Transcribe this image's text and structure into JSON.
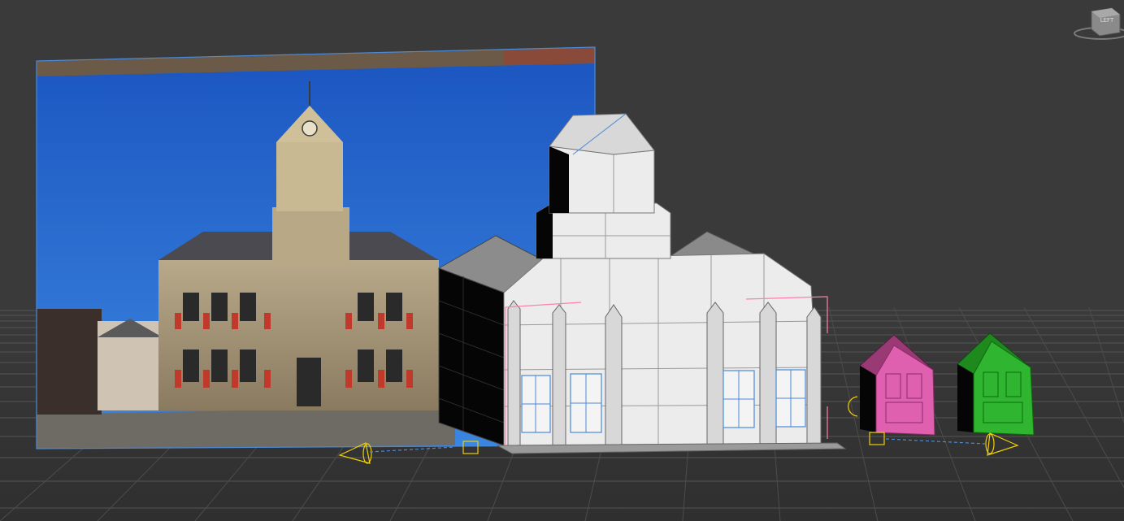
{
  "viewport": {
    "viewcube": {
      "face_label": "LEFT"
    },
    "objects": [
      {
        "name": "reference-photo-plane",
        "kind": "textured plane"
      },
      {
        "name": "church-model",
        "kind": "mesh",
        "color": "#e8e8e8"
      },
      {
        "name": "pink-house-model",
        "kind": "mesh",
        "color": "#e060b0"
      },
      {
        "name": "green-house-model",
        "kind": "mesh",
        "color": "#2fb52f"
      },
      {
        "name": "camera-left",
        "kind": "camera",
        "color": "#f0d000"
      },
      {
        "name": "camera-right",
        "kind": "camera",
        "color": "#f0d000"
      }
    ],
    "colors": {
      "background": "#3a3a3a",
      "grid": "#5a5a5a",
      "selection": "#4a8ad8",
      "sky": "#1f63c8",
      "camera": "#f0d000",
      "pink_selection": "#ff7fb0"
    }
  }
}
